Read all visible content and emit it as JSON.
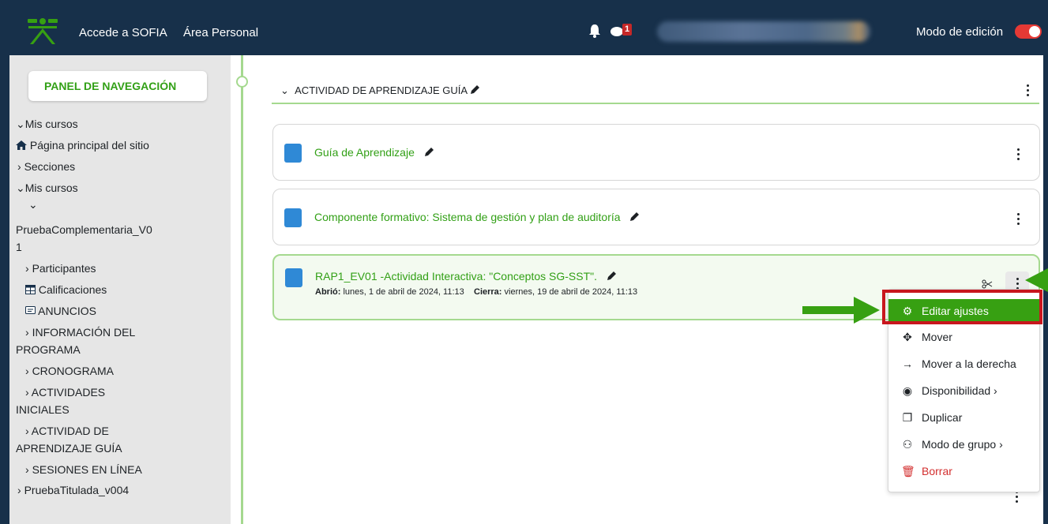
{
  "topbar": {
    "links": [
      "Accede a SOFIA",
      "Área Personal"
    ],
    "notification_badge": "1",
    "edit_mode_label": "Modo de edición"
  },
  "sidebar": {
    "panel_title": "PANEL DE NAVEGACIÓN",
    "items": [
      "Mis cursos",
      "Página principal del sitio",
      "Secciones",
      "Mis cursos",
      "PruebaComplementaria_V0",
      "1",
      "Participantes",
      "Calificaciones",
      "ANUNCIOS",
      "INFORMACIÓN DEL",
      "PROGRAMA",
      "CRONOGRAMA",
      "ACTIVIDADES",
      "INICIALES",
      "ACTIVIDAD DE",
      "APRENDIZAJE GUÍA",
      "SESIONES EN LÍNEA",
      "PruebaTitulada_v004"
    ]
  },
  "section": {
    "title": "ACTIVIDAD DE APRENDIZAJE GUÍA"
  },
  "activities": [
    {
      "title": "Guía de Aprendizaje"
    },
    {
      "title": "Componente formativo: Sistema de gestión y plan de auditoría"
    },
    {
      "title": "RAP1_EV01 -Actividad Interactiva: \"Conceptos SG-SST\".",
      "opened_label": "Abrió:",
      "opened_value": "lunes, 1 de abril de 2024, 11:13",
      "closes_label": "Cierra:",
      "closes_value": "viernes, 19 de abril de 2024, 11:13"
    }
  ],
  "menu": {
    "items": [
      {
        "label": "Editar ajustes",
        "icon": "gear-icon"
      },
      {
        "label": "Mover",
        "icon": "move-icon"
      },
      {
        "label": "Mover a la derecha",
        "icon": "arrow-right-icon"
      },
      {
        "label": "Disponibilidad ›",
        "icon": "eye-icon"
      },
      {
        "label": "Duplicar",
        "icon": "copy-icon"
      },
      {
        "label": "Modo de grupo ›",
        "icon": "group-icon"
      },
      {
        "label": "Borrar",
        "icon": "trash-icon"
      }
    ]
  },
  "colors": {
    "topbar": "#17304a",
    "accent_green": "#32a016",
    "highlight_red": "#c8161d",
    "toggle_on": "#e53935"
  }
}
